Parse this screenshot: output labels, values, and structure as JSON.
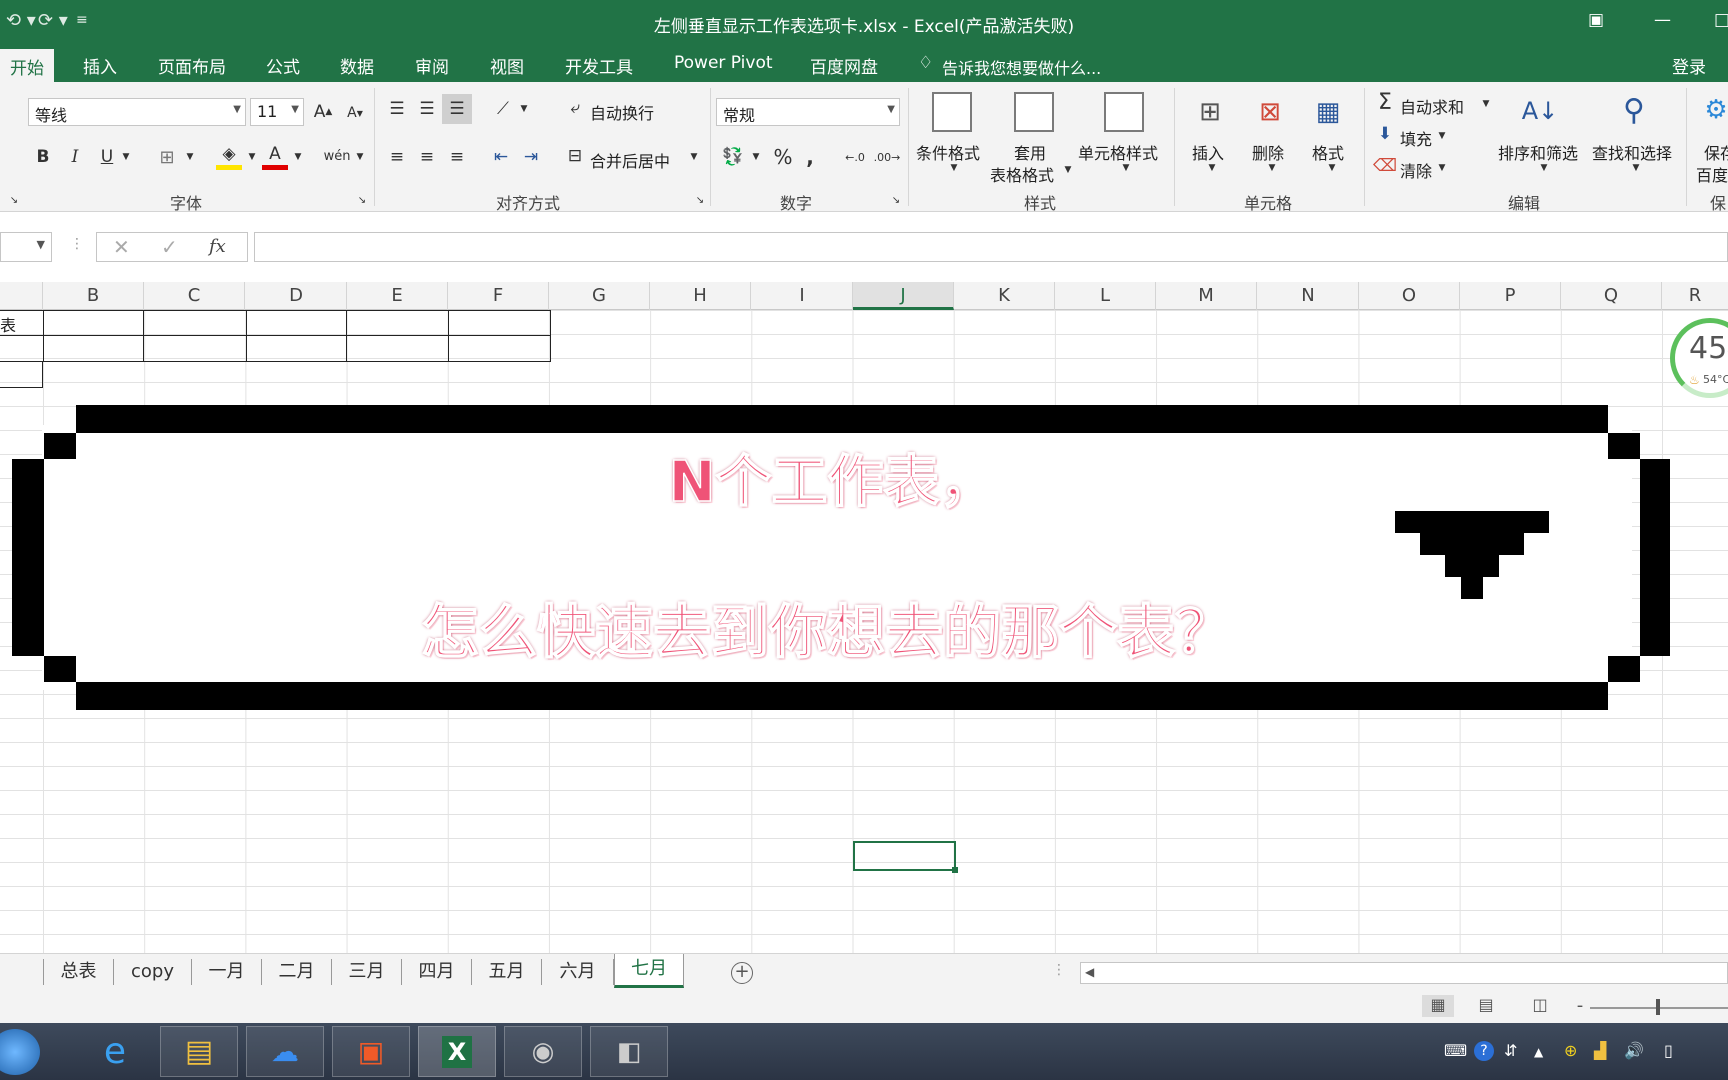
{
  "window": {
    "title": "左侧垂直显示工作表选项卡.xlsx - Excel(产品激活失败)"
  },
  "ribbon_tabs": [
    "开始",
    "插入",
    "页面布局",
    "公式",
    "数据",
    "审阅",
    "视图",
    "开发工具",
    "Power Pivot",
    "百度网盘"
  ],
  "active_tab": "开始",
  "tell_me": "告诉我您想要做什么...",
  "login": "登录",
  "font": {
    "name": "等线",
    "size": "11",
    "group_label": "字体"
  },
  "alignment": {
    "wrap": "自动换行",
    "merge": "合并后居中",
    "group_label": "对齐方式"
  },
  "number": {
    "format": "常规",
    "group_label": "数字"
  },
  "styles": {
    "cond": "条件格式",
    "table_1": "套用",
    "table_2": "表格格式",
    "cell": "单元格样式",
    "group_label": "样式"
  },
  "cells": {
    "insert": "插入",
    "delete": "删除",
    "format": "格式",
    "group_label": "单元格"
  },
  "editing": {
    "autosum": "自动求和",
    "fill": "填充",
    "clear": "清除",
    "sort": "排序和筛选",
    "find": "查找和选择",
    "group_label": "编辑"
  },
  "save_baidu": {
    "l1": "保存",
    "l2": "百度",
    "group_label": "保"
  },
  "columns": [
    "B",
    "C",
    "D",
    "E",
    "F",
    "G",
    "H",
    "I",
    "J",
    "K",
    "L",
    "M",
    "N",
    "O",
    "P",
    "Q",
    "R"
  ],
  "selected_column": "J",
  "cell_a1_partial": "表",
  "banner": {
    "line1": "N个工作表，",
    "line2": "怎么快速去到你想去的那个表？"
  },
  "temperature": {
    "percent": "45",
    "percent_unit": "%",
    "cpu": "54°C"
  },
  "sheets": [
    "总表",
    "copy",
    "一月",
    "二月",
    "三月",
    "四月",
    "五月",
    "六月",
    "七月"
  ],
  "active_sheet": "七月",
  "colors": {
    "excel_green": "#217346",
    "banner_text": "#ef5377"
  }
}
